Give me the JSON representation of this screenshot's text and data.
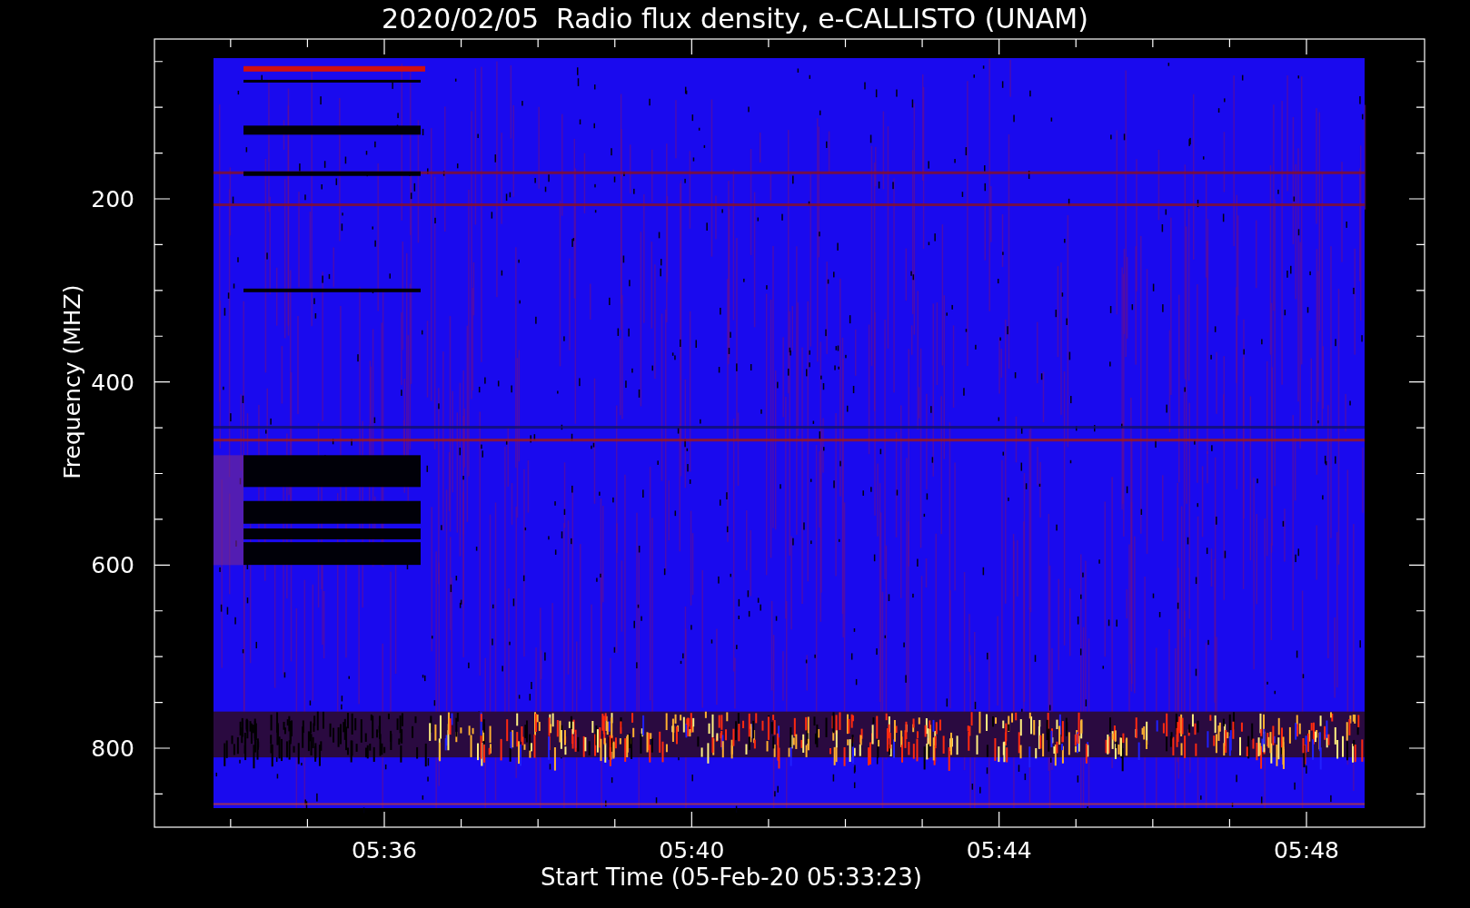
{
  "plot": {
    "title": "2020/02/05  Radio flux density, e-CALLISTO (UNAM)",
    "xlabel": "Start Time (05-Feb-20 05:33:23)",
    "ylabel": "Frequency (MHZ)",
    "xticks": [
      "05:36",
      "05:40",
      "05:44",
      "05:48"
    ],
    "yticks": [
      "200",
      "400",
      "600",
      "800"
    ]
  }
}
